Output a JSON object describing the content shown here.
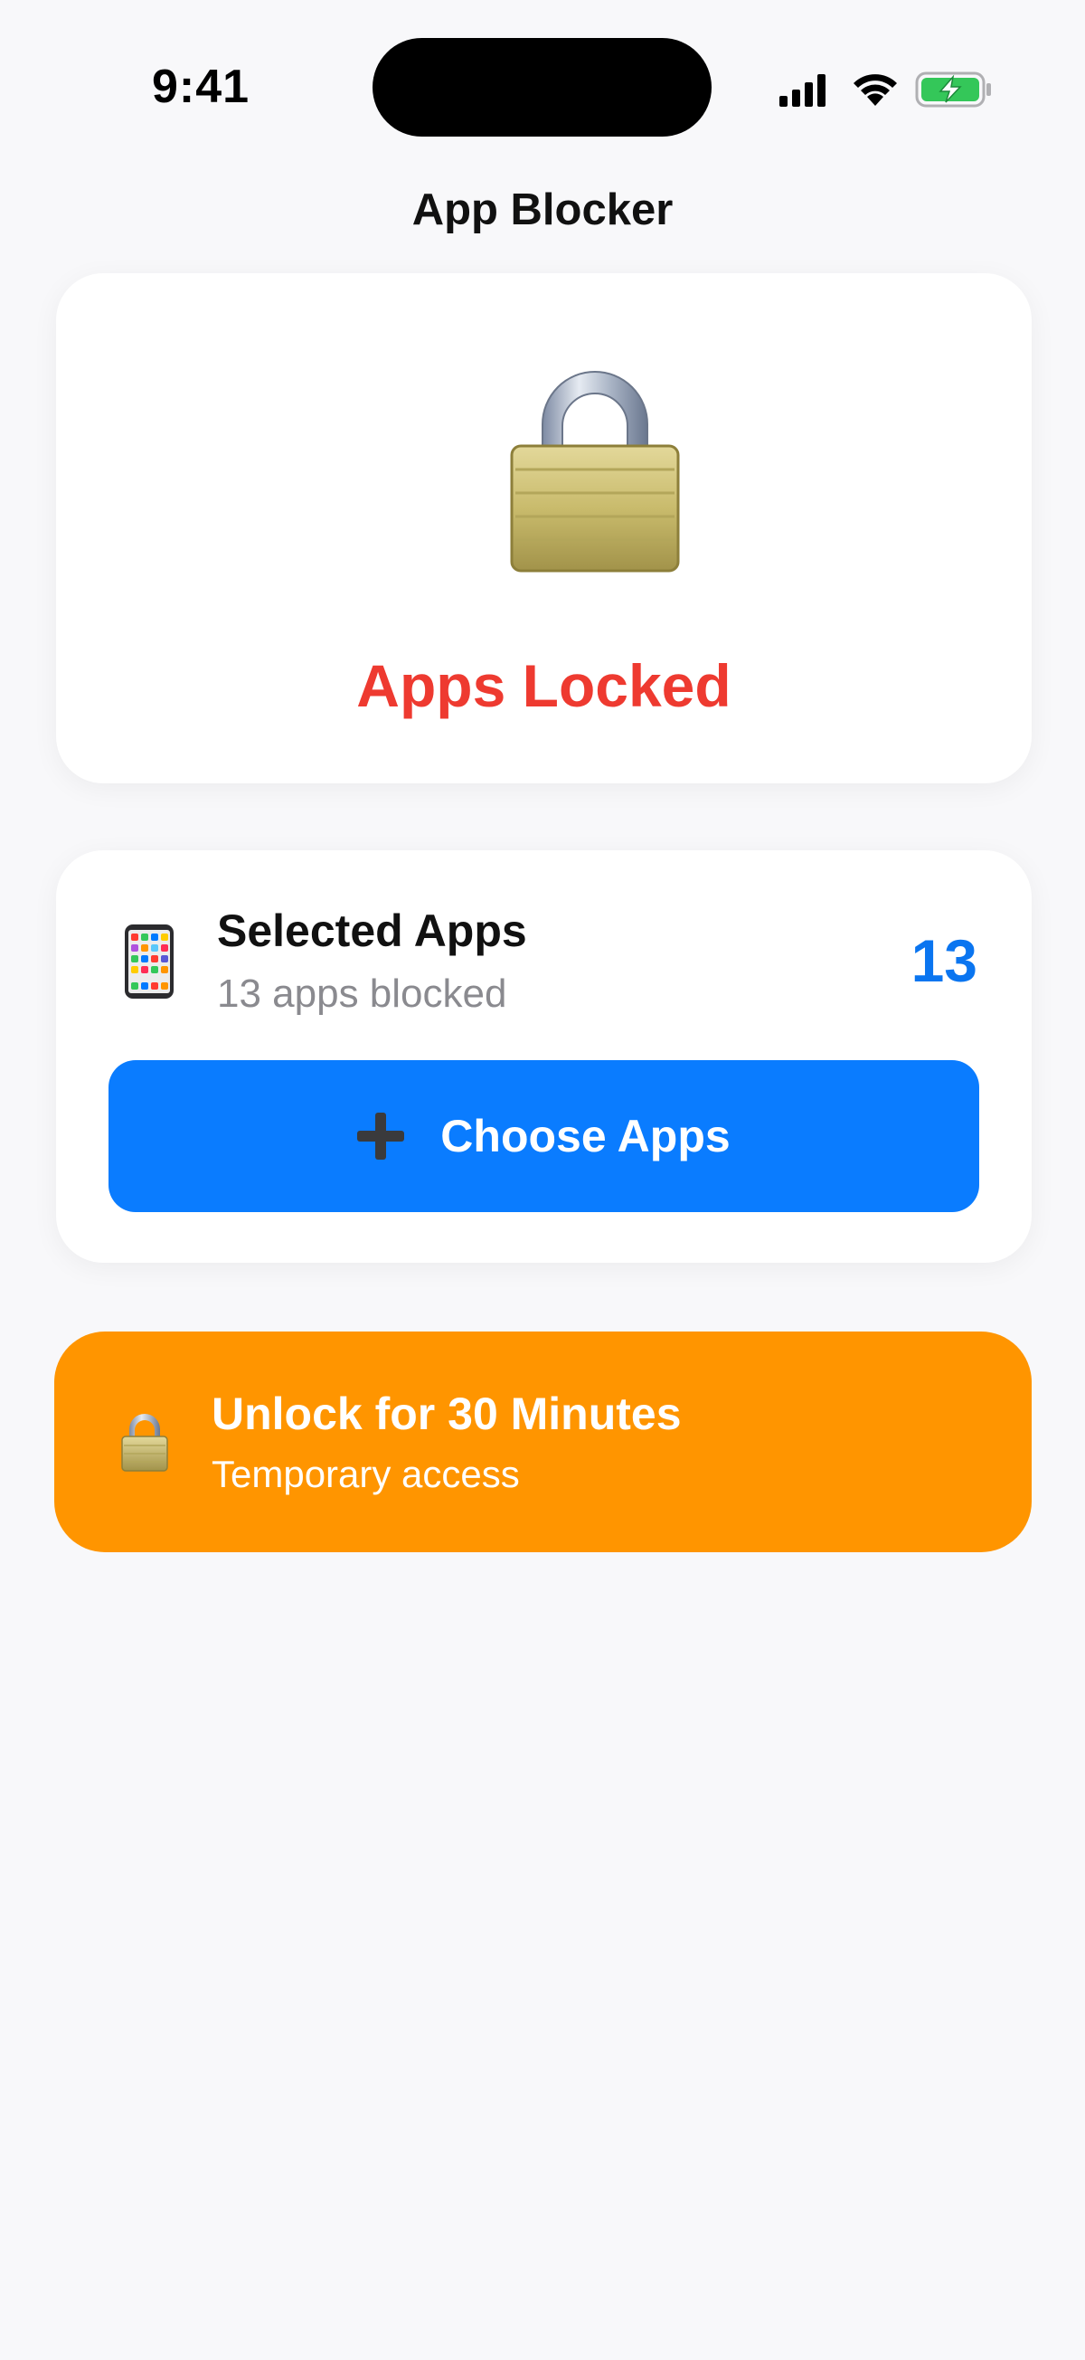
{
  "status_bar": {
    "time": "9:41",
    "icons": [
      "cellular-signal-icon",
      "wifi-icon",
      "battery-charging-icon"
    ]
  },
  "nav": {
    "title": "App Blocker"
  },
  "lock_card": {
    "icon": "padlock-icon",
    "status": "Apps Locked"
  },
  "apps_card": {
    "icon": "mobile-phone-icon",
    "title": "Selected Apps",
    "subtitle": "13 apps blocked",
    "count": "13",
    "button": {
      "icon": "plus-icon",
      "label": "Choose Apps"
    }
  },
  "unlock_card": {
    "icon": "padlock-icon",
    "title": "Unlock for 30 Minutes",
    "subtitle": "Temporary access"
  },
  "colors": {
    "background": "#f8f8fa",
    "locked_red": "#ee3a30",
    "accent_blue": "#0a7cff",
    "count_blue": "#0a75f0",
    "unlock_orange": "#ff9500",
    "battery_green": "#34c759"
  }
}
